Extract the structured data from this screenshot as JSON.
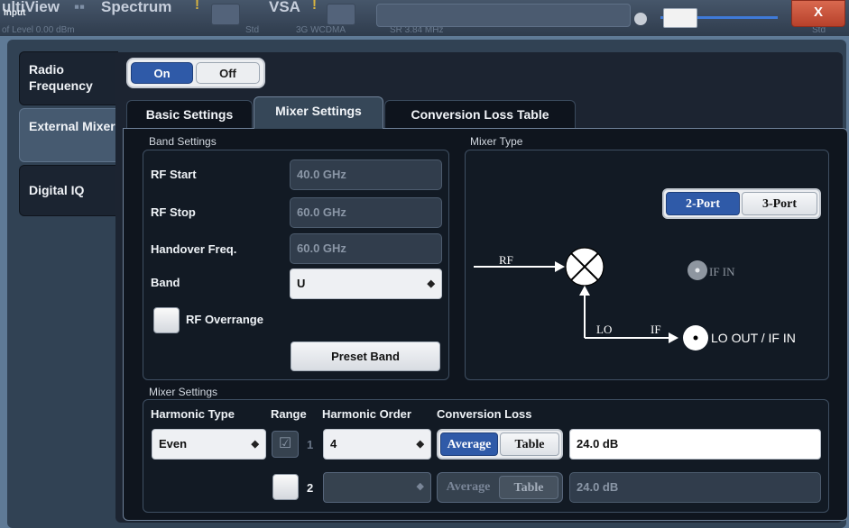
{
  "topbar": {
    "left_title": "ultiView",
    "input_label": "Input",
    "ref_level": "of Level 0.00 dBm",
    "tab_spectrum": "Spectrum",
    "tab_vsa": "VSA",
    "std_label": "Std",
    "std_value": "3G WCDMA",
    "sr_value": "SR 3.84 MHz",
    "right_label": "Std",
    "close_label": "X"
  },
  "sidetabs": [
    {
      "label": "Radio Frequency"
    },
    {
      "label": "External Mixer"
    },
    {
      "label": "Digital IQ"
    }
  ],
  "power": {
    "on_label": "On",
    "off_label": "Off"
  },
  "subtabs": [
    {
      "label": "Basic Settings"
    },
    {
      "label": "Mixer Settings"
    },
    {
      "label": "Conversion Loss Table"
    }
  ],
  "band_settings": {
    "title": "Band Settings",
    "rf_start_label": "RF Start",
    "rf_start_value": "40.0 GHz",
    "rf_stop_label": "RF Stop",
    "rf_stop_value": "60.0 GHz",
    "handover_label": "Handover Freq.",
    "handover_value": "60.0 GHz",
    "band_label": "Band",
    "band_value": "U",
    "rf_overrange_label": "RF Overrange",
    "preset_band_label": "Preset Band"
  },
  "mixer_type": {
    "title": "Mixer Type",
    "port2_label": "2-Port",
    "port3_label": "3-Port",
    "rf_label": "RF",
    "lo_label": "LO",
    "if_label": "IF",
    "if_in_label": "IF IN",
    "lo_out_label": "LO OUT / IF IN"
  },
  "mixer_settings": {
    "title": "Mixer Settings",
    "headers": {
      "harmonic_type": "Harmonic Type",
      "range": "Range",
      "harmonic_order": "Harmonic Order",
      "conversion_loss": "Conversion Loss"
    },
    "row1": {
      "harmonic_type": "Even",
      "range_number": "1",
      "harmonic_order": "4",
      "average_label": "Average",
      "table_label": "Table",
      "value": "24.0 dB"
    },
    "row2": {
      "range_number": "2",
      "average_label": "Average",
      "table_label": "Table",
      "value": "24.0 dB"
    }
  }
}
